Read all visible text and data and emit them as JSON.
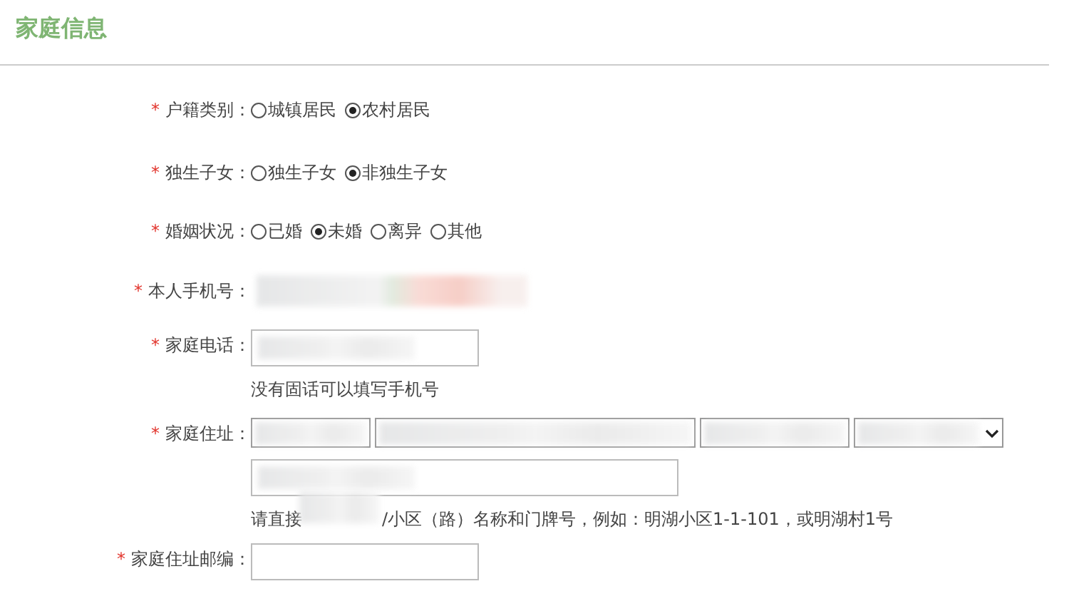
{
  "section_title": "家庭信息",
  "fields": [
    {
      "kind": "radio",
      "marker": "*",
      "label": "户籍类别：",
      "options": [
        {
          "label": "城镇居民",
          "selected": false
        },
        {
          "label": "农村居民",
          "selected": true
        }
      ]
    },
    {
      "kind": "radio",
      "marker": "*",
      "label": "独生子女：",
      "options": [
        {
          "label": "独生子女",
          "selected": false
        },
        {
          "label": "非独生子女",
          "selected": true
        }
      ]
    },
    {
      "kind": "radio",
      "marker": "*",
      "label": "婚姻状况：",
      "options": [
        {
          "label": "已婚",
          "selected": false
        },
        {
          "label": "未婚",
          "selected": true
        },
        {
          "label": "离异",
          "selected": false
        },
        {
          "label": "其他",
          "selected": false
        }
      ]
    },
    {
      "kind": "hidden",
      "marker": "*",
      "label": "本人手机号："
    },
    {
      "kind": "text",
      "marker": "*",
      "label": "家庭电话：",
      "hint": "没有固话可以填写手机号"
    },
    {
      "kind": "address",
      "marker": "*",
      "label": "家庭住址：",
      "hint_parts": [
        "请直接",
        "/小区（路）名称和门牌号，例如：明湖小区1-1-101，或明湖村1号"
      ]
    },
    {
      "kind": "text",
      "marker": "*",
      "label": "家庭住址邮编："
    }
  ]
}
